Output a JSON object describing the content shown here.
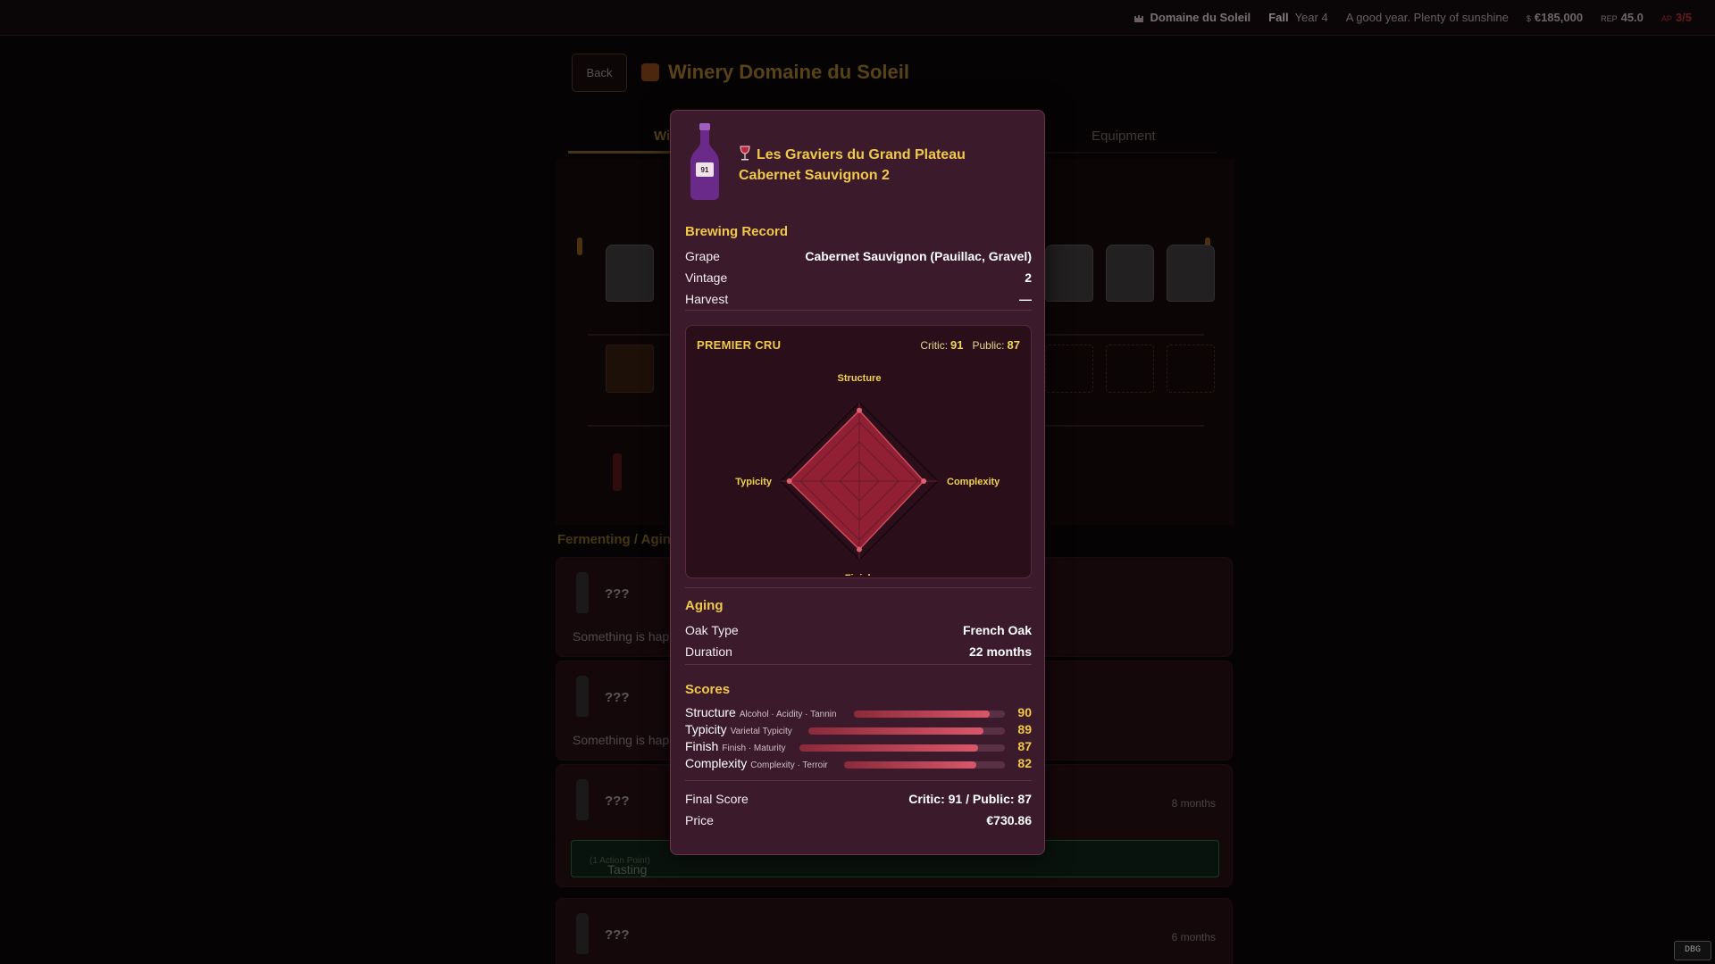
{
  "topbar": {
    "estate": "Domaine du Soleil",
    "season": "Fall",
    "year": "Year 4",
    "weather": "A good year. Plenty of sunshine",
    "money_label": "$",
    "money": "€185,000",
    "rep_label": "REP",
    "rep": "45.0",
    "ap_label": "AP",
    "ap": "3/5"
  },
  "page": {
    "back_label": "Back",
    "title": "Winery Domaine du Soleil",
    "tabs": [
      {
        "label": "Wi"
      },
      {
        "label": "Equipment"
      }
    ],
    "tank_label": "???",
    "cask_label": "???",
    "section_label": "Fermenting / Agin",
    "cards": [
      {
        "name": "???",
        "desc": "Something is hap",
        "months": ""
      },
      {
        "name": "???",
        "desc": "Something is hap",
        "months": ""
      },
      {
        "name": "???",
        "desc": "",
        "months": "8 months"
      },
      {
        "name": "???",
        "desc": "",
        "months": "6 months"
      }
    ],
    "tasting": {
      "label": "Tasting",
      "cost": "(1 Action Point)"
    }
  },
  "modal": {
    "bottle_label": "91",
    "title_line1": "Les Graviers du Grand Plateau",
    "title_line2": "Cabernet Sauvignon 2",
    "brewing": {
      "heading": "Brewing Record",
      "rows": [
        {
          "k": "Grape",
          "v": "Cabernet Sauvignon (Pauillac, Gravel)"
        },
        {
          "k": "Vintage",
          "v": "2"
        },
        {
          "k": "Harvest",
          "v": "—"
        }
      ]
    },
    "radar": {
      "tier": "PREMIER CRU",
      "critic_label": "Critic:",
      "critic": "91",
      "public_label": "Public:",
      "public": "87",
      "axes": [
        "Structure",
        "Complexity",
        "Finish",
        "Typicity"
      ],
      "values": [
        90,
        82,
        87,
        89
      ],
      "max": 100,
      "fill_color": "#a3233a",
      "grid_color": "#1a0a10"
    },
    "aging": {
      "heading": "Aging",
      "rows": [
        {
          "k": "Oak Type",
          "v": "French Oak"
        },
        {
          "k": "Duration",
          "v": "22 months"
        }
      ]
    },
    "scores": {
      "heading": "Scores",
      "items": [
        {
          "name": "Structure",
          "sub": "Alcohol · Acidity · Tannin",
          "value": 90
        },
        {
          "name": "Typicity",
          "sub": "Varietal Typicity",
          "value": 89
        },
        {
          "name": "Finish",
          "sub": "Finish · Maturity",
          "value": 87
        },
        {
          "name": "Complexity",
          "sub": "Complexity · Terroir",
          "value": 82
        }
      ]
    },
    "final": {
      "rows": [
        {
          "k": "Final Score",
          "v": "Critic: 91 / Public: 87"
        },
        {
          "k": "Price",
          "v": "€730.86"
        }
      ]
    }
  },
  "debug_label": "DBG"
}
